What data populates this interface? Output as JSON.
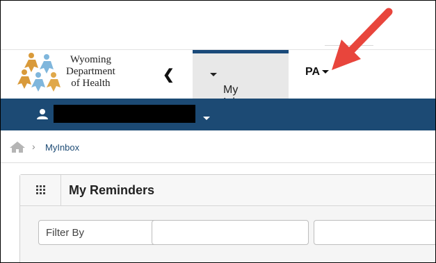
{
  "logo": {
    "line1": "Wyoming",
    "line2": "Department",
    "line3": "of Health"
  },
  "nav": {
    "collapse_glyph": "❮",
    "inbox_tab": "My Inbox",
    "pa_tab": "PA"
  },
  "userbar": {
    "icon": "user-icon",
    "name_redacted": true
  },
  "breadcrumb": {
    "home_icon": "home-icon",
    "separator": "›",
    "current": "MyInbox"
  },
  "panel": {
    "icon": "grid-icon",
    "title": "My Reminders",
    "filter_label": "Filter By",
    "filter_value_placeholder": "",
    "search_placeholder": ""
  },
  "colors": {
    "userbar_bg": "#1c4a74",
    "tab_active_border": "#1a4a7a",
    "arrow": "#e8453c"
  }
}
